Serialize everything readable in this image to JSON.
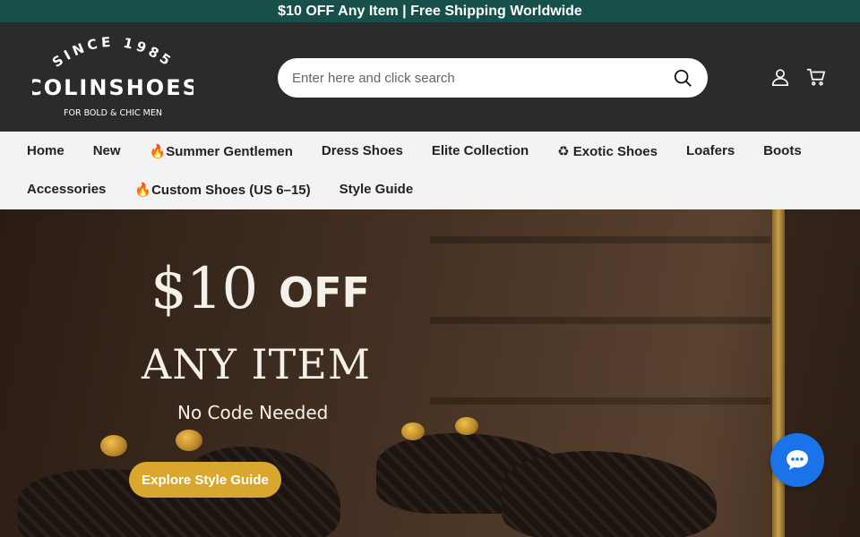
{
  "announcement": "$10 OFF Any Item | Free Shipping Worldwide",
  "logo": {
    "since": "SINCE 1985",
    "name": "COLINSHOES",
    "tagline": "FOR BOLD & CHIC MEN"
  },
  "search": {
    "placeholder": "Enter here and click search"
  },
  "icons": {
    "search": "search-icon",
    "account": "user-icon",
    "cart": "cart-icon",
    "chat": "chat-icon"
  },
  "nav": {
    "row1": [
      "Home",
      "New",
      "🔥Summer Gentlemen",
      "Dress Shoes",
      "Elite Collection",
      "♻ Exotic Shoes",
      "Loafers",
      "Boots"
    ],
    "row2": [
      "Accessories",
      "🔥Custom Shoes (US 6–15)",
      "Style Guide"
    ]
  },
  "hero": {
    "amount": "$10",
    "off": "OFF",
    "headline": "ANY ITEM",
    "subline": "No Code Needed",
    "cta": "Explore Style Guide"
  },
  "colors": {
    "announcement_bg": "#17504a",
    "header_bg": "#2b2b2b",
    "cta_bg": "#d9a62e",
    "chat_bg": "#1a73e8"
  }
}
